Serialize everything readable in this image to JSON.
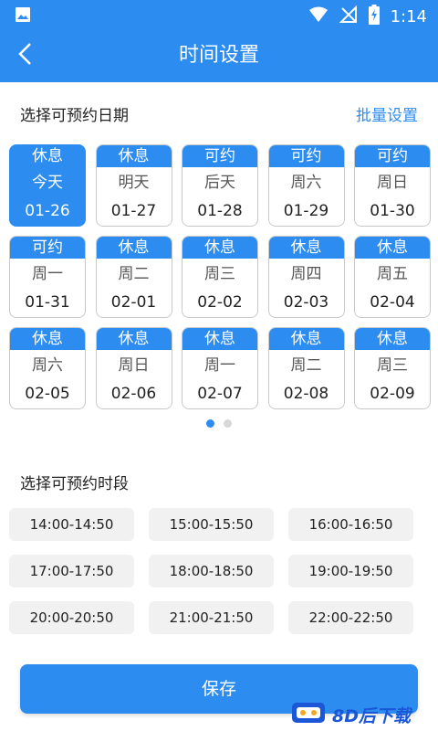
{
  "status_bar": {
    "time": "1:14"
  },
  "header": {
    "title": "时间设置"
  },
  "date_section": {
    "title": "选择可预约日期",
    "batch_label": "批量设置"
  },
  "dates": [
    {
      "status": "休息",
      "weekday": "今天",
      "date": "01-26",
      "selected": true
    },
    {
      "status": "休息",
      "weekday": "明天",
      "date": "01-27",
      "selected": false
    },
    {
      "status": "可约",
      "weekday": "后天",
      "date": "01-28",
      "selected": false
    },
    {
      "status": "可约",
      "weekday": "周六",
      "date": "01-29",
      "selected": false
    },
    {
      "status": "可约",
      "weekday": "周日",
      "date": "01-30",
      "selected": false
    },
    {
      "status": "可约",
      "weekday": "周一",
      "date": "01-31",
      "selected": false
    },
    {
      "status": "休息",
      "weekday": "周二",
      "date": "02-01",
      "selected": false
    },
    {
      "status": "休息",
      "weekday": "周三",
      "date": "02-02",
      "selected": false
    },
    {
      "status": "休息",
      "weekday": "周四",
      "date": "02-03",
      "selected": false
    },
    {
      "status": "休息",
      "weekday": "周五",
      "date": "02-04",
      "selected": false
    },
    {
      "status": "休息",
      "weekday": "周六",
      "date": "02-05",
      "selected": false
    },
    {
      "status": "休息",
      "weekday": "周日",
      "date": "02-06",
      "selected": false
    },
    {
      "status": "休息",
      "weekday": "周一",
      "date": "02-07",
      "selected": false
    },
    {
      "status": "休息",
      "weekday": "周二",
      "date": "02-08",
      "selected": false
    },
    {
      "status": "休息",
      "weekday": "周三",
      "date": "02-09",
      "selected": false
    }
  ],
  "pager": {
    "pages": 2,
    "active": 0
  },
  "time_section": {
    "title": "选择可预约时段"
  },
  "slots": [
    "14:00-14:50",
    "15:00-15:50",
    "16:00-16:50",
    "17:00-17:50",
    "18:00-18:50",
    "19:00-19:50",
    "20:00-20:50",
    "21:00-21:50",
    "22:00-22:50"
  ],
  "save_label": "保存",
  "watermark": {
    "text": "8D后下载"
  },
  "colors": {
    "primary": "#2d8cf0",
    "slot_bg": "#f1f1f1",
    "card_border": "#c9c9c9",
    "watermark": "#1a56d6"
  },
  "icons": {
    "status_left": "image-icon",
    "wifi": "wifi-icon",
    "signal": "signal-off-icon",
    "battery": "battery-charging-icon",
    "back": "back-arrow-icon"
  }
}
